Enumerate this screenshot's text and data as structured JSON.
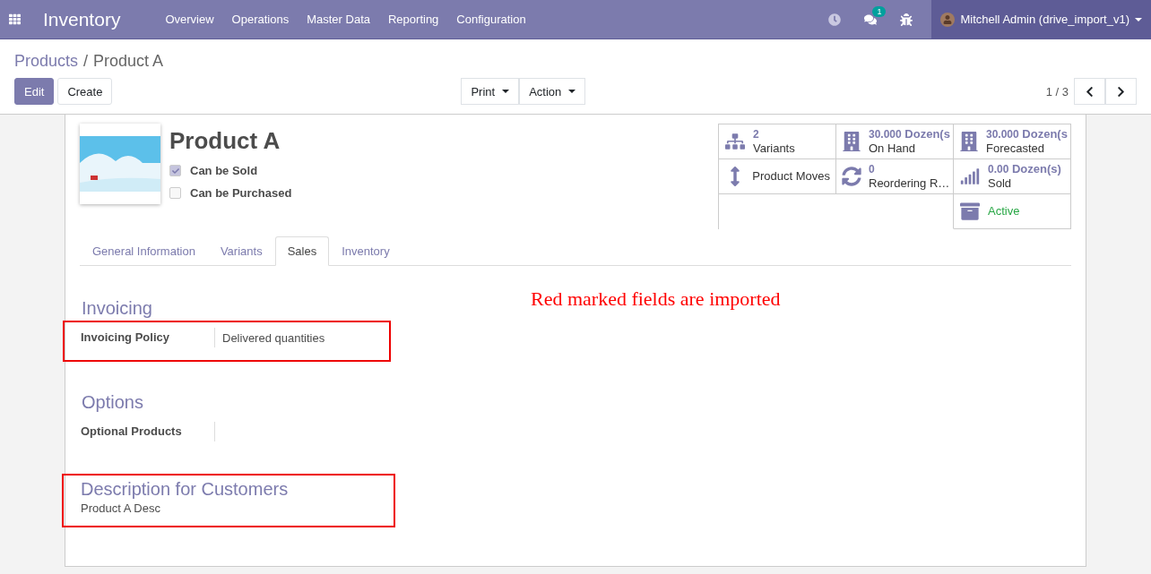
{
  "navbar": {
    "app_name": "Inventory",
    "menu": [
      "Overview",
      "Operations",
      "Master Data",
      "Reporting",
      "Configuration"
    ],
    "message_count": "1",
    "user": "Mitchell Admin (drive_import_v1)"
  },
  "breadcrumb": {
    "parent": "Products",
    "separator": "/",
    "current": "Product A"
  },
  "buttons": {
    "edit": "Edit",
    "create": "Create",
    "print": "Print",
    "action": "Action"
  },
  "pager": "1 / 3",
  "product": {
    "name": "Product A",
    "options": [
      {
        "label": "Can be Sold",
        "checked": true
      },
      {
        "label": "Can be Purchased",
        "checked": false
      }
    ]
  },
  "stat_buttons": [
    {
      "kind": "variants",
      "value": "2",
      "label": "Variants"
    },
    {
      "kind": "on_hand",
      "value": "30.000",
      "unit": "Dozen(s",
      "label": "On Hand"
    },
    {
      "kind": "forecast",
      "value": "30.000",
      "unit": "Dozen(s",
      "label": "Forecasted"
    },
    {
      "kind": "moves",
      "label": "Product Moves"
    },
    {
      "kind": "reorder",
      "value": "0",
      "label": "Reordering R…"
    },
    {
      "kind": "sold",
      "value": "0.00",
      "unit": "Dozen(s)",
      "label": "Sold"
    },
    {
      "kind": "active",
      "label": "Active"
    }
  ],
  "tabs": [
    {
      "label": "General Information",
      "selected": false
    },
    {
      "label": "Variants",
      "selected": false
    },
    {
      "label": "Sales",
      "selected": true
    },
    {
      "label": "Inventory",
      "selected": false
    }
  ],
  "annotation": "Red marked fields are imported",
  "sections": [
    {
      "kind": "fields",
      "title": "Invoicing",
      "marked": false,
      "fields": [
        {
          "label": "Invoicing Policy",
          "value": "Delivered quantities",
          "marked": true
        }
      ]
    },
    {
      "kind": "fields",
      "title": "Options",
      "marked": false,
      "fields": [
        {
          "label": "Optional Products",
          "marked": false
        }
      ]
    },
    {
      "kind": "text",
      "title": "Description for Customers",
      "text": "Product A Desc",
      "marked": true
    }
  ]
}
